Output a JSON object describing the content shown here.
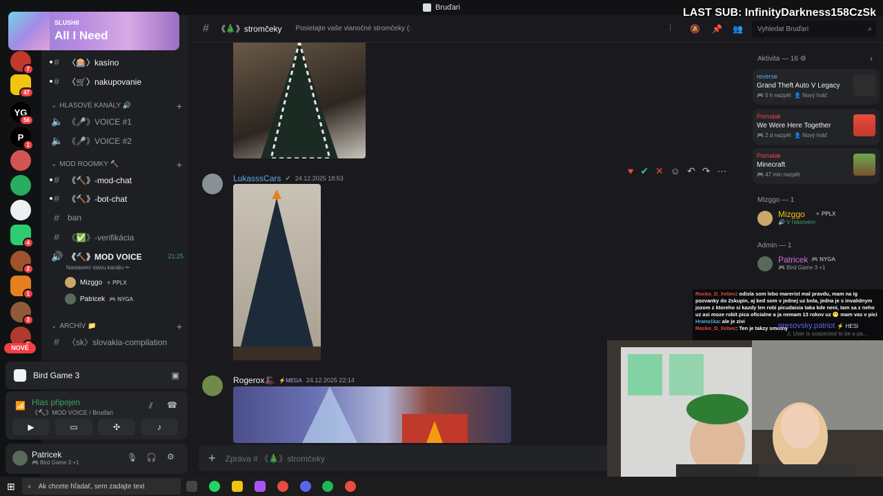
{
  "window": {
    "title": "Bruďari"
  },
  "stream_overlay": {
    "last_sub": "LAST SUB: InfinityDarkness158CzSk",
    "now_playing": {
      "artist": "SLUSHII",
      "song": "All I Need"
    }
  },
  "servers": [
    {
      "badge": "7"
    },
    {
      "badge": "47"
    },
    {
      "label": "YG",
      "badge": "56"
    },
    {
      "label": "P",
      "badge": "1"
    },
    {
      "badge": ""
    },
    {
      "badge": ""
    },
    {
      "badge": ""
    },
    {
      "badge": "4"
    },
    {
      "badge": "2"
    },
    {
      "badge": "1"
    },
    {
      "badge": "3"
    },
    {
      "badge": "2"
    }
  ],
  "new_label": "NOVÉ",
  "channels": {
    "text1": [
      {
        "name": "〈🎰〉kasíno"
      },
      {
        "name": "〈🛒〉nakupovanie"
      }
    ],
    "voice_category": "HLASOVÉ KANÁLY 🔊",
    "voice": [
      {
        "name": "《🎤》VOICE #1"
      },
      {
        "name": "《🎤》VOICE #2"
      }
    ],
    "mod_category": "MOD ROOMKY 🔨",
    "mod": [
      {
        "name": "《🔨》-mod-chat"
      },
      {
        "name": "《🔨》-bot-chat"
      },
      {
        "name": "ban"
      },
      {
        "name": "《✅》-verifikácia"
      }
    ],
    "mod_voice": {
      "name": "《🔨》MOD VOICE",
      "time": "21:25",
      "status": "Nastavení stavu kanálu ✏"
    },
    "voice_users": [
      {
        "name": "Mizggo",
        "tag": "✧ PPLX"
      },
      {
        "name": "Patricek",
        "tag": "🎮 NYGA"
      }
    ],
    "archive_category": "ARCHÍV 📁",
    "archive": [
      {
        "name": "〈sk〉slovakia-compilation"
      }
    ]
  },
  "activity_panel": {
    "game": "Bird Game 3"
  },
  "voice_panel": {
    "status": "Hlas připojen",
    "channel": "《🔨》MOD VOICE / Bruďari"
  },
  "user_panel": {
    "name": "Patricek",
    "status": "🎮 Bird Game 3 +1"
  },
  "header": {
    "channel": "《🎄》stromčeky",
    "topic": "Posielajte vaše vianočné stromčeky (:",
    "search_placeholder": "Vyhledat Bruďari"
  },
  "messages": [
    {
      "author": "LukasssCars",
      "timestamp": "24.12.2025 18:53",
      "author_color": "#5dade2"
    },
    {
      "author": "Rogerox🎩",
      "tag": "⚡MEGA",
      "timestamp": "24.12.2025 22:14",
      "author_color": "#f2f3f5"
    }
  ],
  "composer": {
    "placeholder": "Zpráva # 《🎄》stromčeky"
  },
  "members": {
    "activity_header": "Aktivita — 16 ⚙",
    "activities": [
      {
        "user": "reverse",
        "game": "Grand Theft Auto V Legacy",
        "time": "🎮 5 h nazpět",
        "extra": "👤 Nový hráč"
      },
      {
        "user": "Pomalak",
        "game": "We Were Here Together",
        "time": "🎮 2 d nazpět",
        "extra": "👤 Nový hráč"
      },
      {
        "user": "Pomalak",
        "game": "Minecraft",
        "time": "🎮 47 min nazpět",
        "extra": ""
      }
    ],
    "groups": [
      {
        "label": "Mizggo — 1",
        "member": "Mizggo",
        "tag": "✧ PPLX",
        "sub": "🔊 V hlasovém"
      },
      {
        "label": "Admin — 1",
        "member": "Patricek",
        "tag": "🎮 NYGA",
        "sub": "🎮 Bird Game 3 +1"
      }
    ]
  },
  "chat_overlay": [
    {
      "user": "Rocko_D_Xebec",
      "text": ": odisla som lebo marerist mal pravdu, mam na ig pozvanky do 2skupin, aj ked som v jednej uz bola, jedna je s invalidnym jozom z ktoreho si kazdy len robi picudaisia taka kde neni, tam sa z neho uz asi moze robit pica oficialne a ja nemam 13 rokov uz 😁 mam vas v pici"
    },
    {
      "user": "Hrano1ka",
      "text": ": ale je zivi"
    },
    {
      "user": "Rocko_D_Xebec",
      "text": ": Ten je takzy smutny"
    }
  ],
  "chat_overlay_under": {
    "name": "presovsky.patriot",
    "tag": "⚡ HESI",
    "sub": "⚠ User is suspected to be a pa..."
  },
  "taskbar": {
    "search_placeholder": "Ak chcete hľadať, sem zadajte text"
  }
}
